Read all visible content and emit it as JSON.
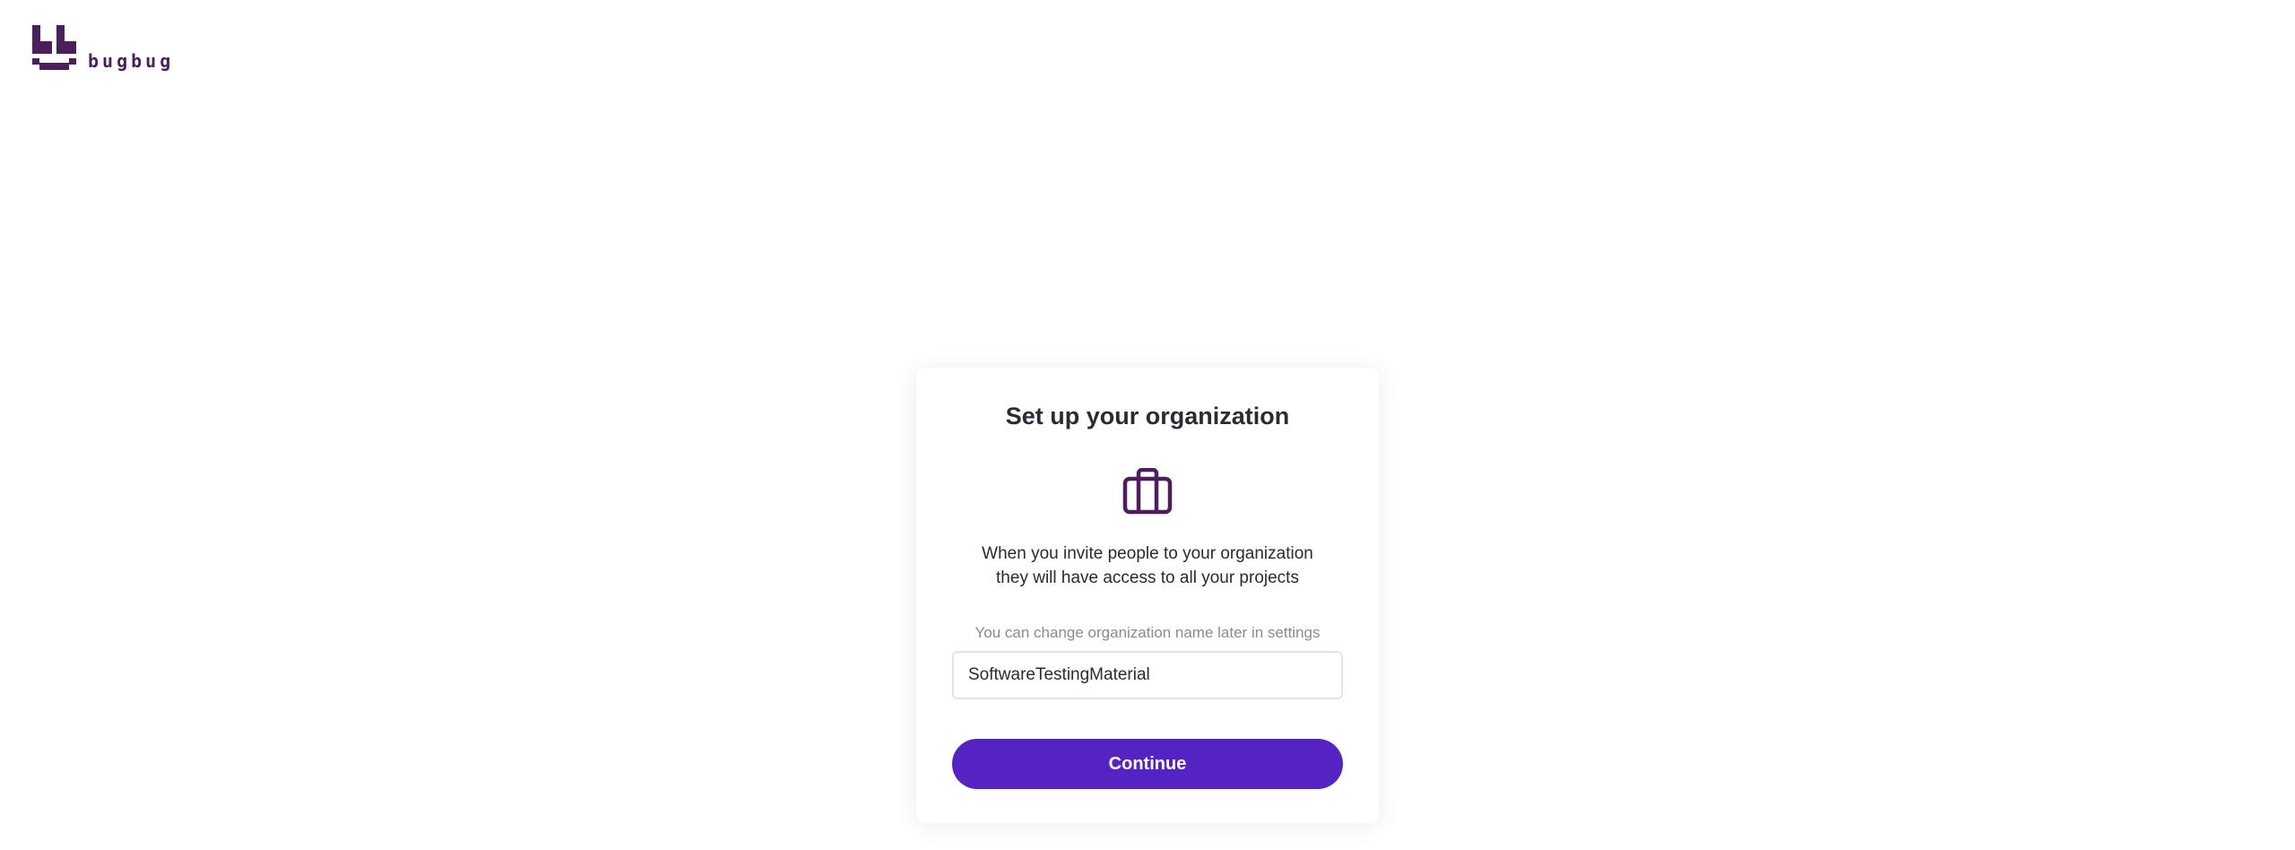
{
  "brand": {
    "name": "bugbug",
    "color": "#4a1f5c",
    "icon": "bugbug-logo-icon"
  },
  "card": {
    "title": "Set up your organization",
    "icon": "briefcase-icon",
    "description_line1": "When you invite people to your organization",
    "description_line2": "they will have access to all your projects",
    "helper_text": "You can change organization name later in settings",
    "input_value": "SoftwareTestingMaterial",
    "continue_label": "Continue"
  },
  "colors": {
    "accent": "#5522c4",
    "icon": "#4a1f5c"
  }
}
